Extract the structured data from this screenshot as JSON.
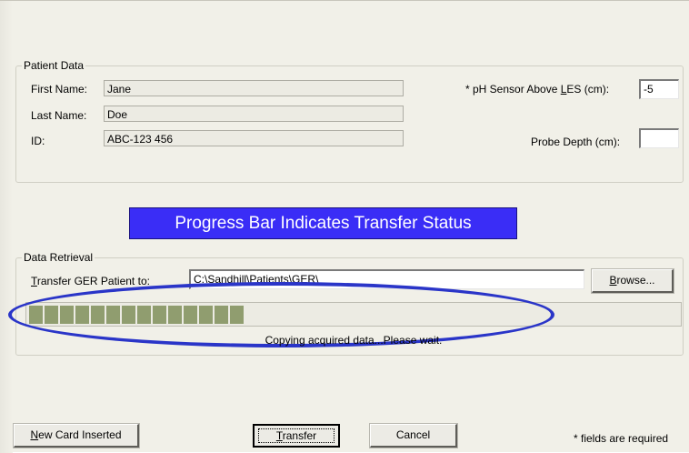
{
  "patient_data": {
    "legend": "Patient Data",
    "first_name_label": "First Name:",
    "first_name_value": "Jane",
    "last_name_label": "Last Name:",
    "last_name_value": "Doe",
    "id_label": "ID:",
    "id_value": "ABC-123 456",
    "ph_sensor_prefix": "* pH Sensor Above ",
    "ph_sensor_accel": "L",
    "ph_sensor_suffix": "ES (cm):",
    "ph_sensor_value": "-5",
    "probe_depth_label": "Probe Depth (cm):",
    "probe_depth_value": ""
  },
  "banner": {
    "text": "Progress Bar Indicates Transfer Status"
  },
  "data_retrieval": {
    "legend": "Data Retrieval",
    "transfer_label_accel": "T",
    "transfer_label_rest": "ransfer GER Patient to:",
    "path_value": "C:\\Sandhill\\Patients\\GER\\",
    "browse_accel": "B",
    "browse_rest": "rowse...",
    "progress_fraction": 0.31,
    "progress_segments": 14,
    "status_text": "Copying acquired data...Please wait."
  },
  "footer": {
    "new_card_accel": "N",
    "new_card_rest": "ew Card Inserted",
    "transfer_accel": "T",
    "transfer_rest": "ransfer",
    "cancel_label": "Cancel",
    "required_note": "* fields are required"
  },
  "colors": {
    "dialog_bg": "#f1f0e8",
    "banner_bg": "#3a2df6",
    "progress_fill": "#909d6f",
    "annotation_ellipse": "#2a35c8"
  }
}
